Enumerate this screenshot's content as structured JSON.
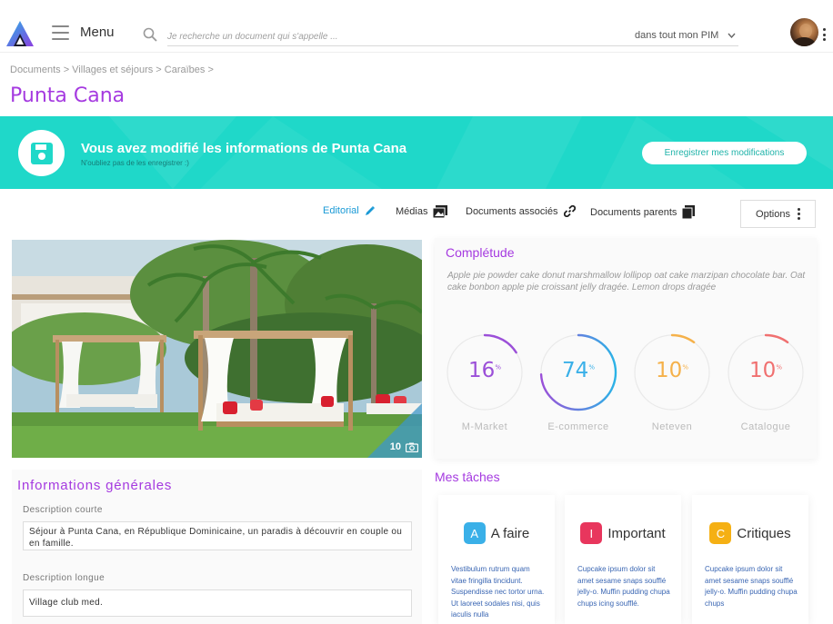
{
  "header": {
    "menu_label": "Menu",
    "search_placeholder": "Je recherche un document qui s'appelle ...",
    "search_scope": "dans tout mon PIM"
  },
  "breadcrumb": "Documents > Villages et séjours > Caraïbes >",
  "page_title": "Punta Cana",
  "banner": {
    "title": "Vous avez modifié les informations de Punta Cana",
    "subtitle": "N'oubliez pas de les enregistrer :)",
    "save_button": "Enregistrer mes modifications",
    "color": "#1fd8c9"
  },
  "tabs": [
    {
      "label": "Editorial",
      "icon": "pencil-icon",
      "active": true
    },
    {
      "label": "Médias",
      "icon": "images-icon",
      "active": false
    },
    {
      "label": "Documents associés",
      "icon": "link-icon",
      "active": false
    },
    {
      "label": "Documents parents",
      "icon": "documents-icon",
      "active": false
    }
  ],
  "options_label": "Options",
  "hero": {
    "photo_count": "10",
    "icon": "camera-icon"
  },
  "completude": {
    "title": "Complétude",
    "description": "Apple pie powder cake donut marshmallow lollipop oat cake marzipan chocolate bar. Oat cake bonbon apple pie croissant jelly dragée. Lemon drops dragée",
    "gauges": [
      {
        "label": "M-Market",
        "value": "16",
        "unit": "%",
        "color": "#9b4fd8"
      },
      {
        "label": "E-commerce",
        "value": "74",
        "unit": "%",
        "color": "#3ab0e8"
      },
      {
        "label": "Neteven",
        "value": "10",
        "unit": "%",
        "color": "#f5b14a"
      },
      {
        "label": "Catalogue",
        "value": "10",
        "unit": "%",
        "color": "#f07070"
      }
    ]
  },
  "infos": {
    "title": "Informations générales",
    "short_label": "Description courte",
    "short_value": "Séjour à Punta Cana, en République Dominicaine, un paradis à découvrir en couple ou en famille.",
    "long_label": "Description longue",
    "long_value": "Village club med."
  },
  "tasks": {
    "title": "Mes tâches",
    "items": [
      {
        "badge": "A",
        "name": "A faire",
        "color": "#3ab0e8",
        "text": "Vestibulum rutrum quam vitae fringilla tincidunt. Suspendisse nec tortor urna. Ut laoreet sodales nisi, quis iaculis nulla"
      },
      {
        "badge": "I",
        "name": "Important",
        "color": "#e8365d",
        "text": "Cupcake ipsum dolor sit amet sesame snaps soufflé jelly-o. Muffin pudding chupa chups icing soufflé."
      },
      {
        "badge": "C",
        "name": "Critiques",
        "color": "#f5b014",
        "text": "Cupcake ipsum dolor sit amet sesame snaps soufflé jelly-o. Muffin pudding chupa chups"
      }
    ]
  }
}
